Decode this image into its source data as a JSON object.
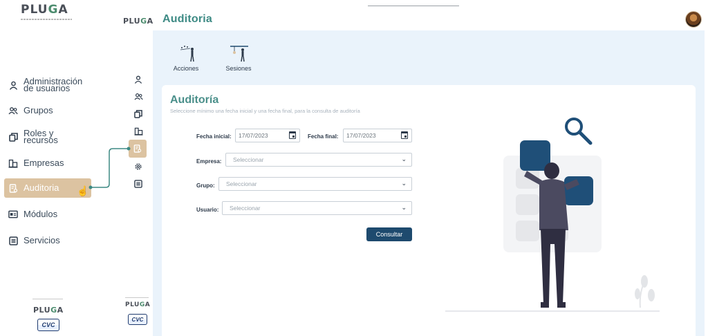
{
  "brand": {
    "logo_text_1": "PLU",
    "logo_text_2": "G",
    "logo_text_3": "A"
  },
  "header": {
    "title": "Auditoria"
  },
  "sidebar": {
    "items": [
      {
        "label_line1": "Administración",
        "label_line2": "de usuarios",
        "icon": "user-icon"
      },
      {
        "label_line1": "Grupos",
        "label_line2": "",
        "icon": "group-icon"
      },
      {
        "label_line1": "Roles y",
        "label_line2": "recursos",
        "icon": "copy-icon"
      },
      {
        "label_line1": "Empresas",
        "label_line2": "",
        "icon": "building-icon"
      },
      {
        "label_line1": "Auditoria",
        "label_line2": "",
        "icon": "audit-icon",
        "active": true
      },
      {
        "label_line1": "Módulos",
        "label_line2": "",
        "icon": "module-icon"
      },
      {
        "label_line1": "Servicios",
        "label_line2": "",
        "icon": "list-icon"
      }
    ]
  },
  "tabs": [
    {
      "label": "Acciones"
    },
    {
      "label": "Sesiones"
    }
  ],
  "card": {
    "title": "Auditoría",
    "subtitle": "Seleccione mínimo una fecha inicial y una fecha final, para la consulta de auditoría"
  },
  "form": {
    "fecha_inicial_label": "Fecha inicial:",
    "fecha_inicial_value": "17/07/2023",
    "fecha_final_label": "Fecha final:",
    "fecha_final_value": "17/07/2023",
    "empresa_label": "Empresa:",
    "empresa_placeholder": "Seleccionar",
    "grupo_label": "Grupo:",
    "grupo_placeholder": "Seleccionar",
    "usuario_label": "Usuario:",
    "usuario_placeholder": "Seleccionar",
    "submit_label": "Consultar"
  },
  "footer": {
    "cvc_text": "CVC"
  },
  "colors": {
    "accent": "#3d8a84",
    "active_bg": "#dcc3a1",
    "button": "#1e4a6e",
    "main_bg": "#eaf3fb"
  }
}
